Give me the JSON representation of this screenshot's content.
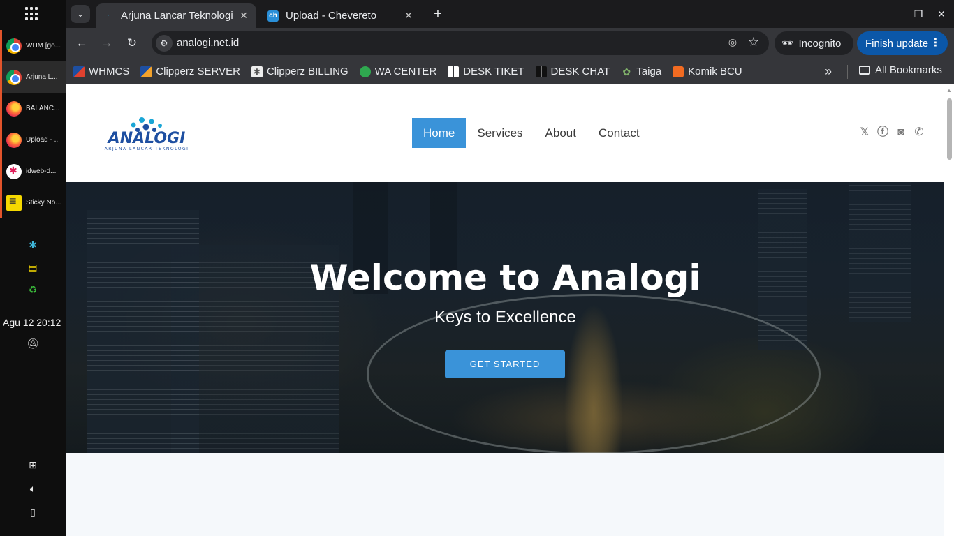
{
  "dock": {
    "windows": [
      {
        "label": "WHM [go...",
        "icon": "chrome-icon"
      },
      {
        "label": "Arjuna L...",
        "icon": "chrome-icon"
      },
      {
        "label": "BALANC...",
        "icon": "firefox-icon"
      },
      {
        "label": "Upload - ...",
        "icon": "firefox-icon"
      },
      {
        "label": "idweb-d...",
        "icon": "slack-icon"
      },
      {
        "label": "Sticky No...",
        "icon": "sticky-notes-icon"
      }
    ],
    "clock": "Agu 12  20:12"
  },
  "tabs": [
    {
      "title": "Arjuna Lancar Teknologi",
      "active": true
    },
    {
      "title": "Upload - Chevereto",
      "favicon_text": "ch",
      "active": false
    }
  ],
  "toolbar": {
    "url": "analogi.net.id",
    "incognito_label": "Incognito",
    "finish_update_label": "Finish update"
  },
  "bookmarks": {
    "items": [
      {
        "label": "WHMCS",
        "color": "#e0412f"
      },
      {
        "label": "Clipperz SERVER",
        "color": "#e0412f"
      },
      {
        "label": "Clipperz BILLING",
        "color": "#dddddd"
      },
      {
        "label": "WA CENTER",
        "color": "#2fa84f"
      },
      {
        "label": "DESK TIKET",
        "color": "#ffffff"
      },
      {
        "label": "DESK CHAT",
        "color": "#111111"
      },
      {
        "label": "Taiga",
        "color": "#7fb069"
      },
      {
        "label": "Komik BCU",
        "color": "#f26b21"
      }
    ],
    "all_label": "All Bookmarks"
  },
  "site": {
    "logo_text": "ANALOGI",
    "logo_tagline": "ARJUNA LANCAR TEKNOLOGI",
    "nav": [
      "Home",
      "Services",
      "About",
      "Contact"
    ],
    "active_nav": "Home",
    "social": [
      "x-icon",
      "facebook-icon",
      "instagram-icon",
      "whatsapp-icon"
    ],
    "hero": {
      "title": "Welcome to Analogi",
      "subtitle": "Keys to Excellence",
      "button": "GET STARTED"
    },
    "accent": "#3a93d9"
  }
}
